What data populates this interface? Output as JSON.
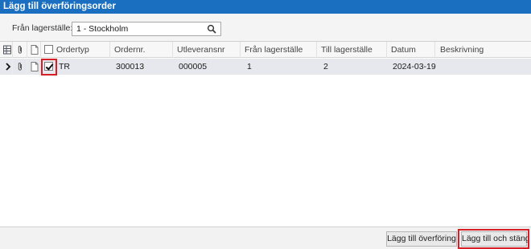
{
  "window": {
    "title": "Lägg till överföringsorder"
  },
  "filter": {
    "label": "Från lagerställe:",
    "value": "1 - Stockholm"
  },
  "table": {
    "columns": [
      "Ordertyp",
      "Ordernr.",
      "Utleveransnr",
      "Från lagerställe",
      "Till lagerställe",
      "Datum",
      "Beskrivning"
    ],
    "rows": [
      {
        "selected": true,
        "ordertyp": "TR",
        "ordernr": "300013",
        "utleveransnr": "000005",
        "fran": "1",
        "till": "2",
        "datum": "2024-03-19",
        "beskrivning": ""
      }
    ]
  },
  "footer": {
    "add_transfer_label": "Lägg till överföring",
    "add_close_label": "Lägg till och stäng"
  },
  "colors": {
    "titlebar": "#1a6fc1",
    "highlight": "#d91f26",
    "selected_row": "#e6e8ed"
  }
}
